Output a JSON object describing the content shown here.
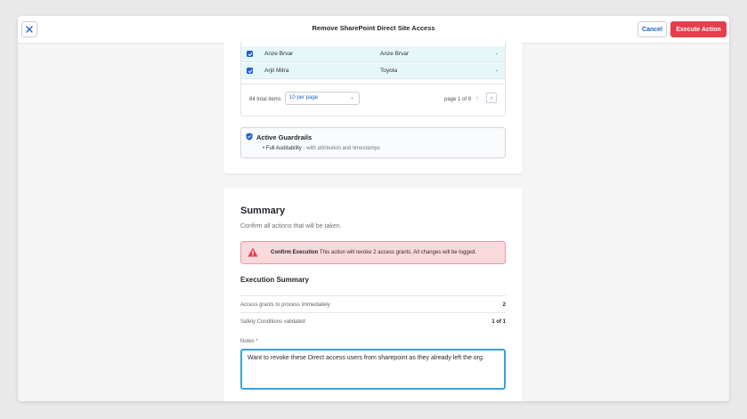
{
  "header": {
    "title": "Remove SharePoint Direct Site Access",
    "cancel_label": "Cancel",
    "execute_label": "Execute Action"
  },
  "table": {
    "rows": [
      {
        "name": "Anze Brvar",
        "display": "Anze Brvar",
        "extra": "-"
      },
      {
        "name": "Arjit Mitra",
        "display": "Toyota",
        "extra": "-"
      }
    ],
    "total": "84 total items",
    "per_page": "10 per page",
    "page": "page 1 of 9"
  },
  "guardrails": {
    "title": "Active Guardrails",
    "item_strong": "Full Auditability",
    "item_rest": " - with attribution and timestamps"
  },
  "summary": {
    "title": "Summary",
    "subtitle": "Confirm all actions that will be taken.",
    "alert_strong": "Confirm Execution",
    "alert_text": " This action will revoke 2 access grants. All changes will be logged.",
    "exec_title": "Execution Summary",
    "rows": [
      {
        "label": "Access grants to process immediately",
        "value": "2"
      },
      {
        "label": "Safety Conditions validated",
        "value": "1 of 1"
      }
    ],
    "notes_label": "Notes",
    "notes_required": "*",
    "notes_value": "Want to revoke these Direct access users from sharepoint as they already left the org."
  },
  "colors": {
    "accent": "#1d5fd1",
    "danger": "#e53e4d",
    "row_selected": "#e6f7fa",
    "alert_bg": "#f9d9db",
    "focus": "#36a3d6"
  },
  "icons": [
    "close-icon",
    "check-icon",
    "chevron-down-icon",
    "chevron-left-icon",
    "chevron-right-icon",
    "shield-icon",
    "warning-icon"
  ]
}
